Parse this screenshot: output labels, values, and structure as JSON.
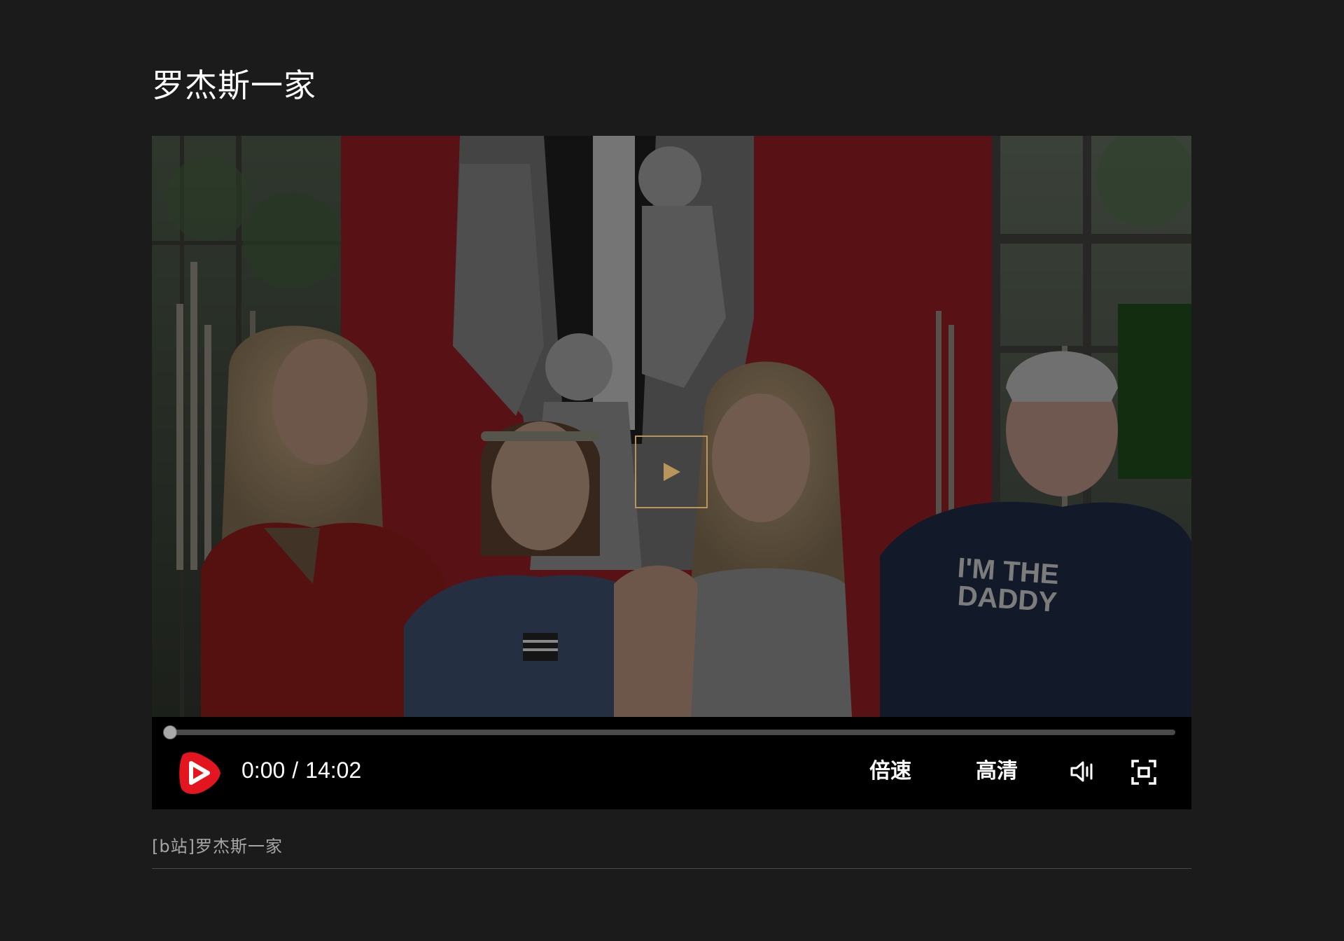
{
  "page": {
    "title": "罗杰斯一家",
    "caption": "[b站]罗杰斯一家"
  },
  "video": {
    "shirt_text_line1": "I'M THE",
    "shirt_text_line2": "DADDY",
    "current_time": "0:00",
    "separator": "/",
    "duration": "14:02",
    "progress_fraction": 0,
    "speed_label": "倍速",
    "quality_label": "高清",
    "icons": {
      "big_play": "play-icon",
      "logo_play": "bilibili-play-logo-icon",
      "volume": "volume-icon",
      "fullscreen": "fullscreen-icon"
    }
  },
  "colors": {
    "background": "#1b1b1c",
    "accent_gold": "#b8955a",
    "logo_red": "#e3161f",
    "red_backdrop": "#8f1e22"
  }
}
